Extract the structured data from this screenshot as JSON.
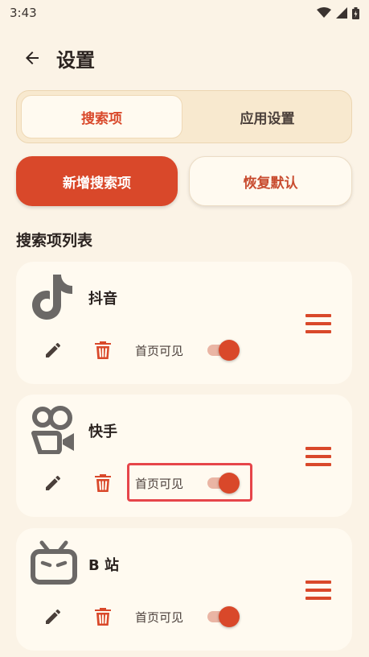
{
  "status_bar": {
    "time": "3:43"
  },
  "header": {
    "title": "设置"
  },
  "tabs": [
    {
      "label": "搜索项",
      "active": true
    },
    {
      "label": "应用设置",
      "active": false
    }
  ],
  "actions": {
    "add": "新增搜索项",
    "reset": "恢复默认"
  },
  "section": {
    "title": "搜索项列表"
  },
  "items": [
    {
      "name": "抖音",
      "icon": "douyin-logo-icon",
      "visible_label": "首页可见",
      "visible": true
    },
    {
      "name": "快手",
      "icon": "kuaishou-logo-icon",
      "visible_label": "首页可见",
      "visible": true
    },
    {
      "name": "B 站",
      "icon": "bilibili-logo-icon",
      "visible_label": "首页可见",
      "visible": true
    }
  ],
  "colors": {
    "accent": "#d9482a",
    "background": "#fbf3e6",
    "card": "#fffaf0",
    "logo_gray": "#6b6866"
  }
}
